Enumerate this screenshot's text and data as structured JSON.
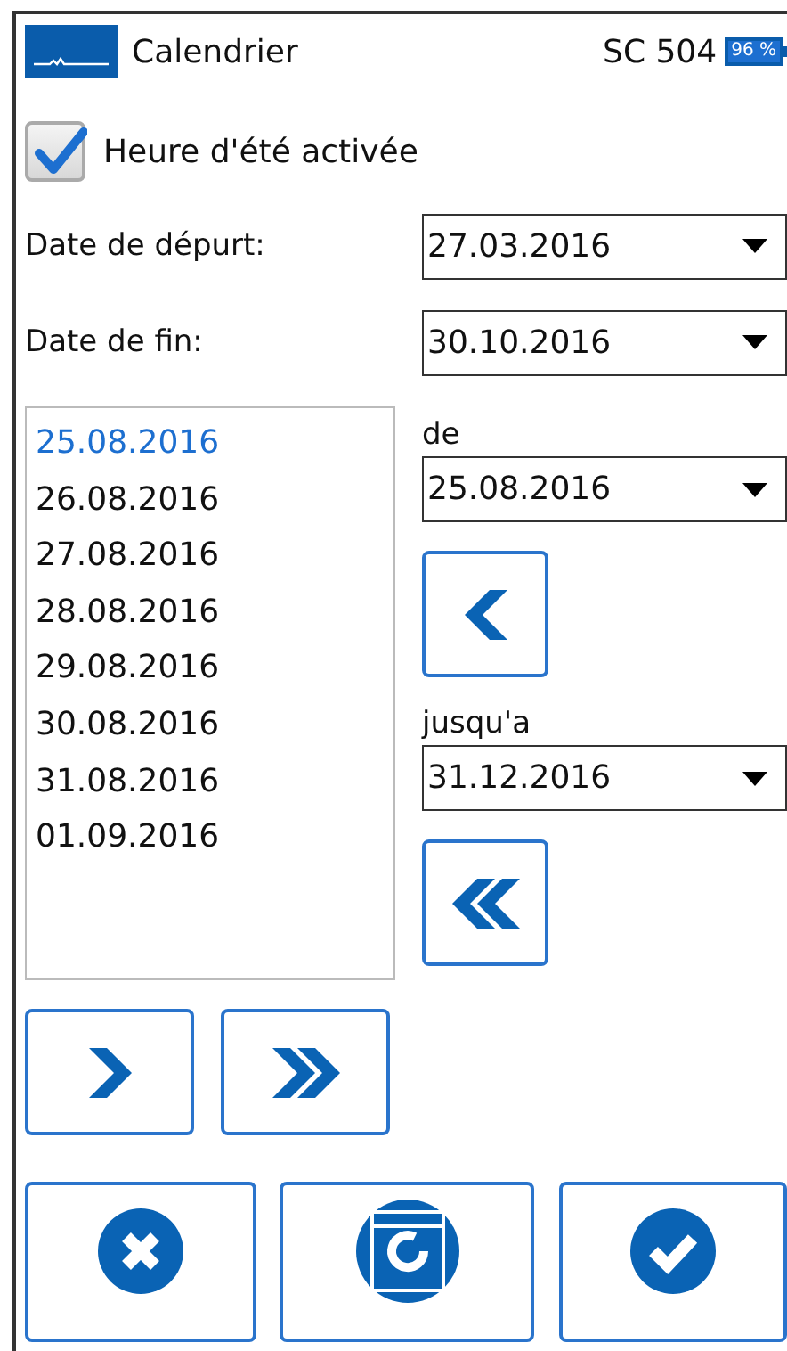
{
  "header": {
    "title": "Calendrier",
    "device": "SC 504",
    "battery": "96 %"
  },
  "dst_checkbox": {
    "label": "Heure d'été activée",
    "checked": true
  },
  "fields": [
    {
      "label": "Date de dépurt:",
      "value": "27.03.2016"
    },
    {
      "label": "Date de fin:",
      "value": "30.10.2016"
    }
  ],
  "dates": [
    {
      "text": "25.08.2016",
      "selected": true
    },
    {
      "text": "26.08.2016",
      "selected": false
    },
    {
      "text": "27.08.2016",
      "selected": false
    },
    {
      "text": "28.08.2016",
      "selected": false
    },
    {
      "text": "29.08.2016",
      "selected": false
    },
    {
      "text": "30.08.2016",
      "selected": false
    },
    {
      "text": "31.08.2016",
      "selected": false
    },
    {
      "text": "01.09.2016",
      "selected": false
    }
  ],
  "from": {
    "label": "de",
    "value": "25.08.2016"
  },
  "to": {
    "label": "jusqu'a",
    "value": "31.12.2016"
  },
  "bottom_buttons": [
    {
      "kind": "cancel"
    },
    {
      "kind": "calendar"
    },
    {
      "kind": "confirm"
    }
  ]
}
